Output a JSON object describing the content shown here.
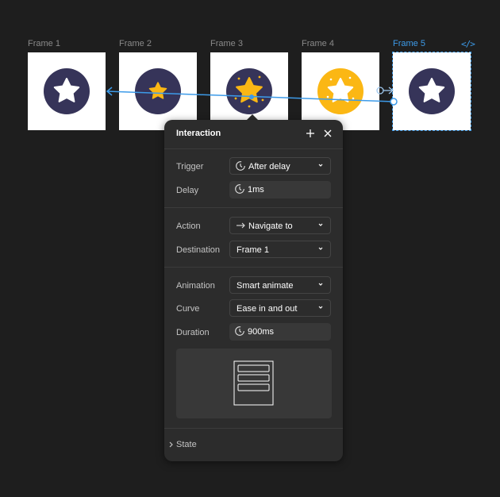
{
  "frames": [
    {
      "label": "Frame 1"
    },
    {
      "label": "Frame 2"
    },
    {
      "label": "Frame 3"
    },
    {
      "label": "Frame 4"
    },
    {
      "label": "Frame 5"
    }
  ],
  "colors": {
    "canvas": "#1e1e1e",
    "panel": "#2c2c2c",
    "accent": "#3d9be9",
    "navy": "#363459",
    "gold": "#fbb714"
  },
  "panel": {
    "title": "Interaction",
    "trigger": {
      "label": "Trigger",
      "value": "After delay",
      "icon": "timer-icon"
    },
    "delay": {
      "label": "Delay",
      "value": "1ms",
      "icon": "timer-icon"
    },
    "action": {
      "label": "Action",
      "value": "Navigate to",
      "icon": "arrow-right-icon"
    },
    "destination": {
      "label": "Destination",
      "value": "Frame 1"
    },
    "animation": {
      "label": "Animation",
      "value": "Smart animate"
    },
    "curve": {
      "label": "Curve",
      "value": "Ease in and out"
    },
    "duration": {
      "label": "Duration",
      "value": "900ms",
      "icon": "timer-icon"
    },
    "state": {
      "label": "State"
    }
  }
}
